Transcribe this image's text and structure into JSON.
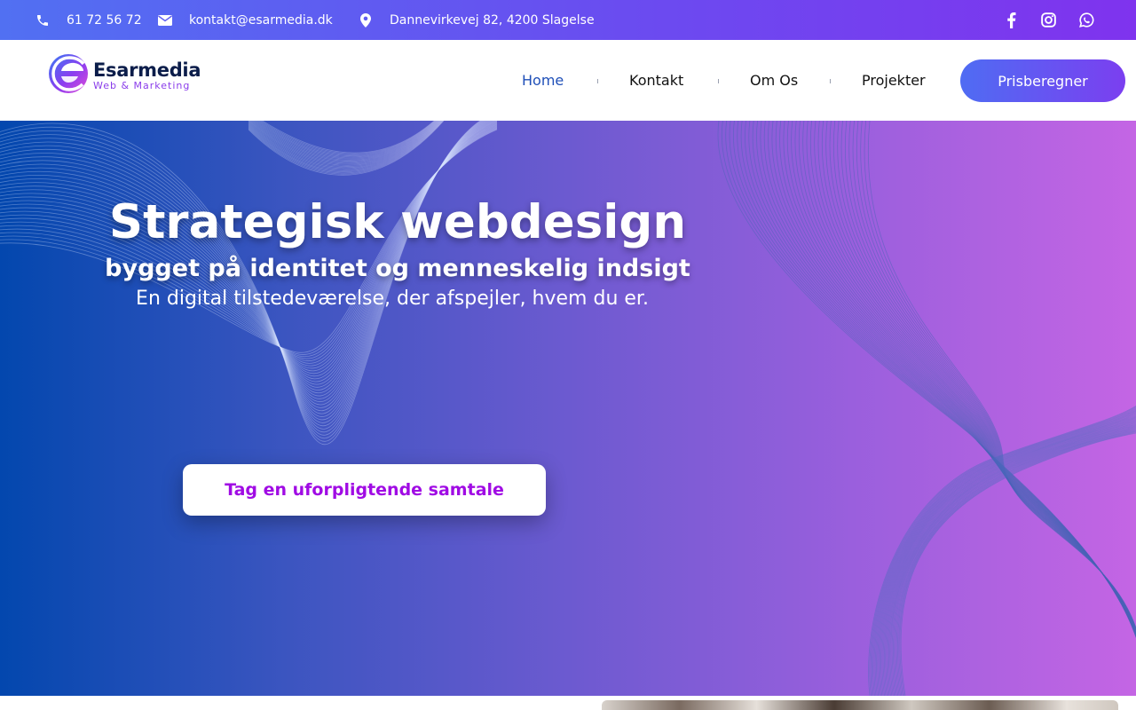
{
  "topbar": {
    "phone": "61 72 56 72",
    "email": "kontakt@esarmedia.dk",
    "address": "Dannevirkevej 82, 4200 Slagelse",
    "icons": {
      "phone": "phone-icon",
      "email": "envelope-icon",
      "address": "map-pin-icon"
    },
    "social": [
      "facebook-icon",
      "instagram-icon",
      "whatsapp-icon"
    ]
  },
  "header": {
    "logo": {
      "name": "Esarmedia",
      "tagline": "Web & Marketing"
    },
    "nav": [
      {
        "label": "Home",
        "active": true
      },
      {
        "label": "Kontakt",
        "active": false
      },
      {
        "label": "Om Os",
        "active": false
      },
      {
        "label": "Projekter",
        "active": false
      }
    ],
    "cta_label": "Prisberegner"
  },
  "hero": {
    "title": "Strategisk webdesign",
    "subtitle": "bygget på identitet og menneskelig indsigt",
    "lead": "En digital tilstedeværelse, der afspejler, hvem du er.",
    "button_label": "Tag en uforpligtende samtale"
  },
  "colors": {
    "topbar_start": "#5170f2",
    "topbar_end": "#7f33ee",
    "hero_start": "#0347ae",
    "hero_end": "#c465e4",
    "nav_active": "#1f4fb8",
    "hero_button_text": "#a00be4",
    "logo_text": "#0b1d4a"
  }
}
